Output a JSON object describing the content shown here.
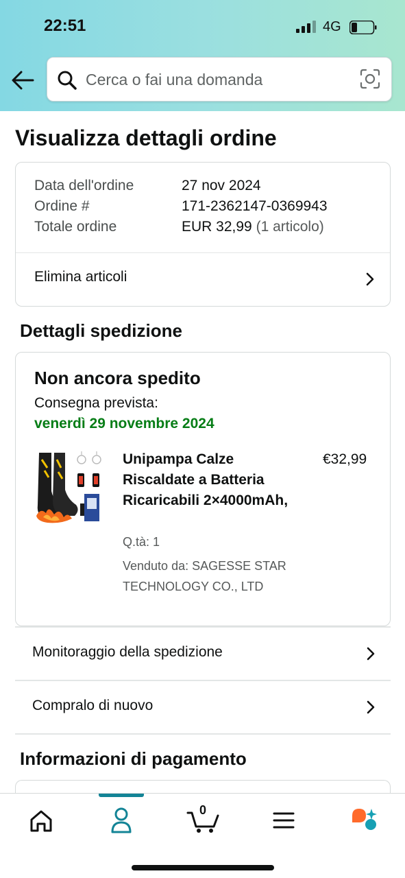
{
  "status_bar": {
    "time": "22:51",
    "network": "4G"
  },
  "search": {
    "placeholder": "Cerca o fai una domanda"
  },
  "page": {
    "title": "Visualizza dettagli ordine"
  },
  "order_summary": {
    "rows": [
      {
        "label": "Data dell'ordine",
        "value": "27 nov 2024",
        "extra": ""
      },
      {
        "label": "Ordine #",
        "value": "171-2362147-0369943",
        "extra": ""
      },
      {
        "label": "Totale ordine",
        "value": "EUR 32,99",
        "extra": "(1 articolo)"
      }
    ],
    "delete_items_label": "Elimina articoli"
  },
  "shipping": {
    "section_title": "Dettagli spedizione",
    "status": "Non ancora spedito",
    "delivery_label": "Consegna prevista:",
    "delivery_date": "venerdì 29 novembre 2024",
    "product": {
      "name": "Unipampa Calze Riscaldate a Batteria Ricaricabili 2×4000mAh,",
      "price": "€32,99",
      "quantity": "Q.tà: 1",
      "seller": "Venduto da: SAGESSE STAR TECHNOLOGY CO., LTD"
    }
  },
  "actions": {
    "track_label": "Monitoraggio della spedizione",
    "buy_again_label": "Compralo di nuovo"
  },
  "payment": {
    "section_title": "Informazioni di pagamento"
  },
  "bottom_nav": {
    "items": [
      {
        "icon": "home-icon"
      },
      {
        "icon": "account-icon",
        "active": true
      },
      {
        "icon": "cart-icon",
        "count": "0"
      },
      {
        "icon": "menu-icon"
      },
      {
        "icon": "rufus-assistant-icon"
      }
    ]
  },
  "colors": {
    "accent": "#138496",
    "delivery_green": "#067d16",
    "assistant_orange": "#ff6a2b",
    "assistant_teal": "#17a0b4"
  }
}
